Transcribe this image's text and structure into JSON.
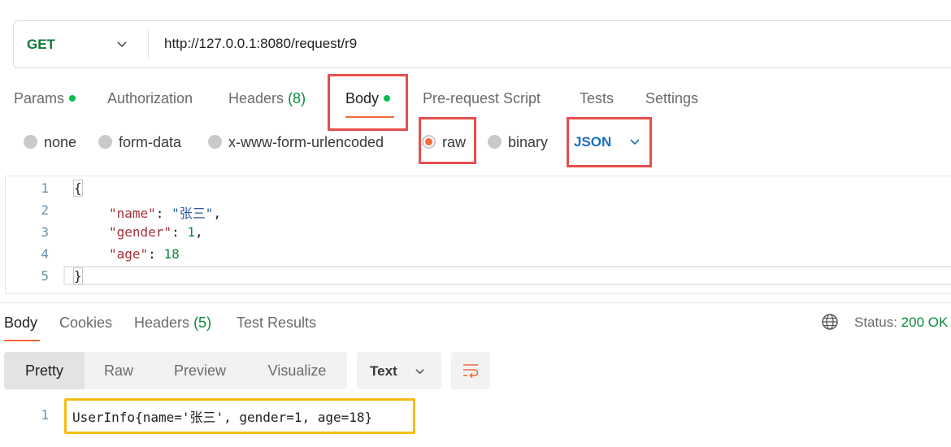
{
  "request": {
    "method": "GET",
    "url": "http://127.0.0.1:8080/request/r9"
  },
  "request_tabs": [
    {
      "label": "Params",
      "dot": true
    },
    {
      "label": "Authorization"
    },
    {
      "label": "Headers",
      "count": "(8)"
    },
    {
      "label": "Body",
      "dot": true,
      "active": true
    },
    {
      "label": "Pre-request Script"
    },
    {
      "label": "Tests"
    },
    {
      "label": "Settings"
    }
  ],
  "body_types": [
    {
      "label": "none"
    },
    {
      "label": "form-data"
    },
    {
      "label": "x-www-form-urlencoded"
    },
    {
      "label": "raw",
      "selected": true
    },
    {
      "label": "binary"
    }
  ],
  "body_format": "JSON",
  "editor": {
    "line_numbers": [
      "1",
      "2",
      "3",
      "4",
      "5"
    ],
    "open_brace": "{",
    "close_brace": "}",
    "fields": [
      {
        "key": "\"name\"",
        "value": "\"张三\"",
        "trail": ","
      },
      {
        "key": "\"gender\"",
        "value": "1",
        "trail": ","
      },
      {
        "key": "\"age\"",
        "value": "18",
        "trail": ""
      }
    ]
  },
  "response_tabs": [
    {
      "label": "Body",
      "active": true
    },
    {
      "label": "Cookies"
    },
    {
      "label": "Headers",
      "count": "(5)"
    },
    {
      "label": "Test Results"
    }
  ],
  "status": {
    "label": "Status:",
    "value": "200 OK"
  },
  "view_modes": [
    "Pretty",
    "Raw",
    "Preview",
    "Visualize"
  ],
  "view_format": "Text",
  "response": {
    "line_number": "1",
    "text": "UserInfo{name='张三', gender=1, age=18}"
  },
  "colors": {
    "accent": "#f26b3a",
    "highlight_box": "#e84e4e",
    "response_box": "#f5bd14",
    "success": "#0b8a3a"
  }
}
